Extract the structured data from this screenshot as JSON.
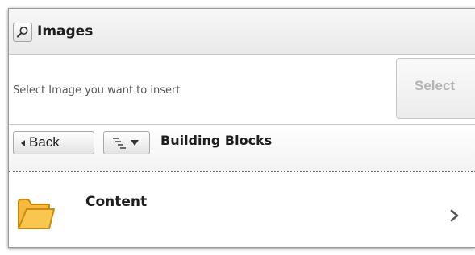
{
  "header": {
    "title": "Images",
    "search_icon": "search-icon"
  },
  "picker": {
    "instruction": "Select Image you want to insert",
    "select_label": "Select"
  },
  "nav": {
    "back_label": "Back",
    "tree_icon": "tree-view-icon",
    "breadcrumb": "Building Blocks"
  },
  "items": [
    {
      "label": "Content",
      "icon": "folder-icon",
      "action_icon": "chevron-right-icon"
    }
  ],
  "colors": {
    "folder_fill": "#f9c74f",
    "folder_stroke": "#c98a0e",
    "separator": "#6e6e6e"
  }
}
